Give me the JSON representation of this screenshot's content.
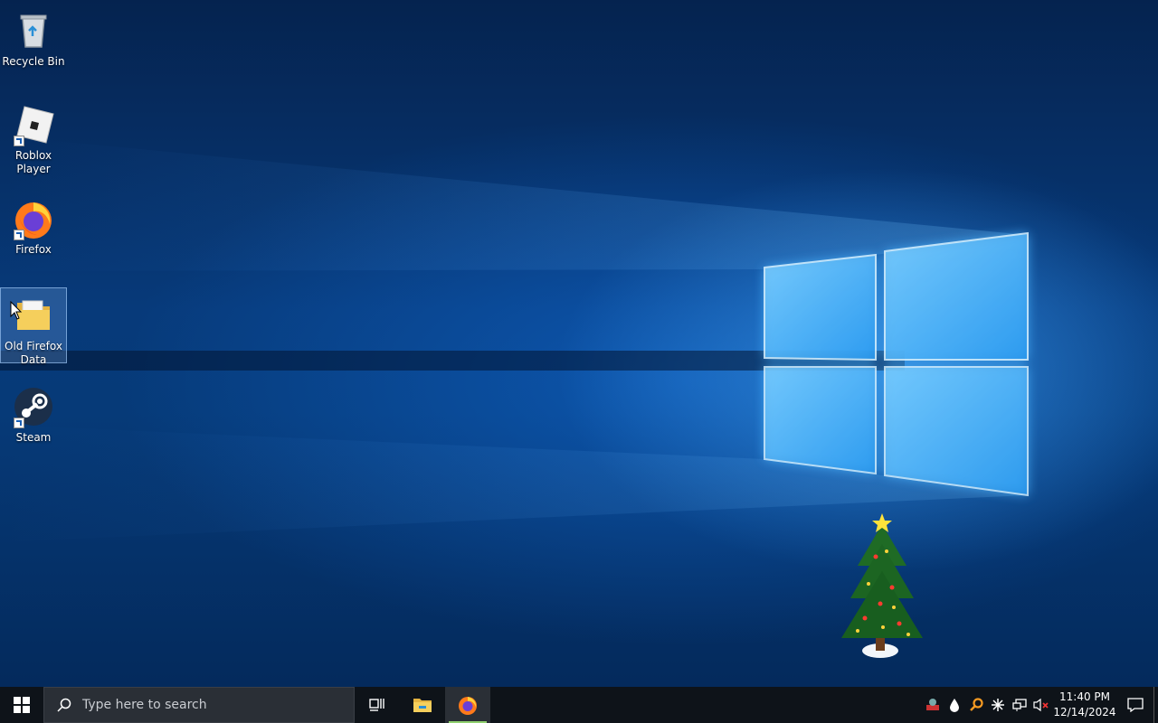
{
  "desktop": {
    "icons": [
      {
        "label": "Recycle Bin",
        "icon": "recycle-bin-icon"
      },
      {
        "label": "Roblox Player",
        "icon": "roblox-icon"
      },
      {
        "label": "Firefox",
        "icon": "firefox-icon"
      },
      {
        "label": "Old Firefox Data",
        "icon": "folder-icon",
        "selected": true
      },
      {
        "label": "Steam",
        "icon": "steam-icon"
      }
    ],
    "widget": "christmas-tree-icon"
  },
  "taskbar": {
    "search_placeholder": "Type here to search",
    "apps": [
      "task-view-icon",
      "file-explorer-icon",
      "firefox-icon"
    ],
    "tray_icons": [
      "people-ink-icon",
      "droplet-icon",
      "magnifier-key-icon",
      "snowflake-icon",
      "network-icon",
      "volume-muted-icon"
    ],
    "clock": {
      "time": "11:40 PM",
      "date": "12/14/2024"
    }
  },
  "colors": {
    "taskbar": "#0e1319",
    "accent_light": "#8fbfff"
  }
}
